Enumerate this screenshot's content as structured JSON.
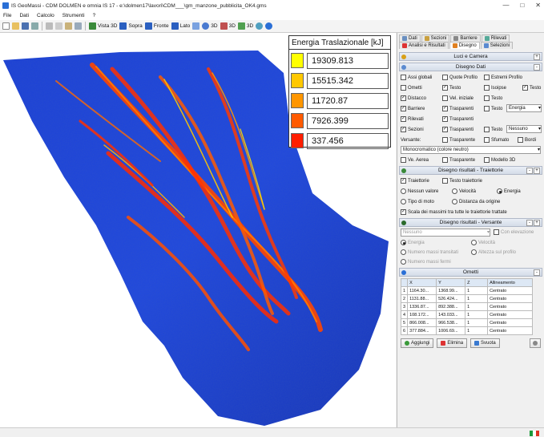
{
  "window": {
    "title": "IS GeoMassi - CDM DOLMEN e omnia IS 17 - e:\\dolmen17\\lavori\\CDM___\\gm_manzone_pubblicita_OK4.gms",
    "minimize": "—",
    "maximize": "□",
    "close": "✕"
  },
  "menu": [
    "File",
    "Dati",
    "Calcolo",
    "Strumenti",
    "?"
  ],
  "toolbar": {
    "vista3d": "Vista 3D",
    "sopra": "Sopra",
    "fronte": "Fronte",
    "lato": "Lato",
    "b3d_1": "3D",
    "b3d_2": "3D",
    "b3d_3": "3D"
  },
  "legend": {
    "title": "Energia Traslazionale [kJ]",
    "entries": [
      {
        "value": "19309.813",
        "color": "#ffff00"
      },
      {
        "value": "15515.342",
        "color": "#ffc800"
      },
      {
        "value": "11720.87",
        "color": "#ff9600"
      },
      {
        "value": "7926.399",
        "color": "#ff5a00"
      },
      {
        "value": "337.456",
        "color": "#ff1e00"
      }
    ]
  },
  "panel": {
    "tabs_row1": [
      "Dati",
      "Sezioni",
      "Barriere",
      "Rilevati"
    ],
    "tabs_row2": [
      "Analisi e Risultati",
      "Disegno",
      "Selezioni"
    ],
    "luci": "Luci e Camera",
    "disegno_dati": {
      "title": "Disegno Dati",
      "r1": [
        "Assi globali",
        "Quote Profilo",
        "Estremi Profilo"
      ],
      "r2": [
        "Ometti",
        "Testo",
        "Isoipse",
        "Testo"
      ],
      "r3": [
        "Distacco",
        "Vel. iniziale",
        "Testo"
      ],
      "r4": [
        "Barriere",
        "Trasparenti",
        "Testo"
      ],
      "r4_sel": "Energia",
      "r5": [
        "Rilevati",
        "Trasparenti"
      ],
      "r6": [
        "Sezioni",
        "Trasparenti",
        "Testo"
      ],
      "r6_sel": "Nessuno",
      "versante_label": "Versante:",
      "versante": [
        "Trasparente",
        "Sfumato",
        "Bordi"
      ],
      "mono": "Monocromatico (colore neutro)",
      "r8": [
        "Ve. Aerea",
        "Trasparente",
        "Modello 3D"
      ]
    },
    "risultati": {
      "title": "Disegno risultati - Traiettorie",
      "traiettorie": "Traiettorie",
      "testo_traiettorie": "Testo traiettorie",
      "radios": [
        "Nessun valore",
        "Velocità",
        "Energia",
        "Tipo di moto",
        "Distanza da origine"
      ],
      "scala": "Scala dei massimi tra tutte le traiettorie trattate"
    },
    "versante": {
      "title": "Disegno risultati - Versante",
      "sel": "Nessuno",
      "con_elevazione": "Con elevazione",
      "radios": [
        "Energia",
        "Velocità",
        "Numero massi transitati",
        "Altezza sul profilo",
        "Numero massi fermi"
      ]
    },
    "ometti": {
      "title": "Ometti",
      "headers": [
        "",
        "X",
        "Y",
        "Z",
        "Allineamento"
      ],
      "rows": [
        [
          "1",
          "1164.30...",
          "1368.99...",
          "1",
          "Centrato"
        ],
        [
          "2",
          "1131.88...",
          "526.424...",
          "1",
          "Centrato"
        ],
        [
          "3",
          "1336.87...",
          "892.388...",
          "1",
          "Centrato"
        ],
        [
          "4",
          "108.172...",
          "143.033...",
          "1",
          "Centrato"
        ],
        [
          "5",
          "866.008...",
          "966.538...",
          "1",
          "Centrato"
        ],
        [
          "6",
          "377.884...",
          "1006.69...",
          "1",
          "Centrato"
        ]
      ],
      "aggiungi": "Aggiungi",
      "elimina": "Elimina",
      "svuota": "Svuota"
    }
  }
}
